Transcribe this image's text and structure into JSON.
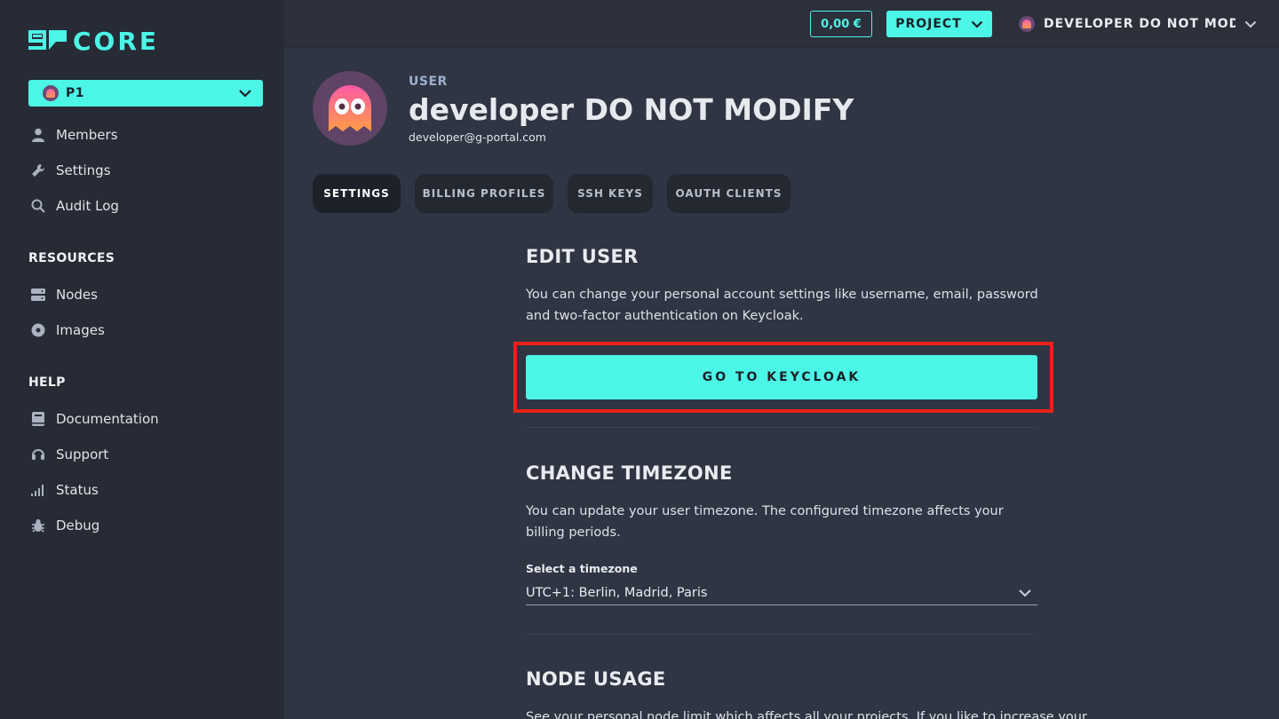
{
  "brand": {
    "name": "CORE",
    "accent": "#4cf6e6"
  },
  "sidebar": {
    "project": {
      "name": "P1"
    },
    "main_items": [
      {
        "label": "Members",
        "icon": "user-icon"
      },
      {
        "label": "Settings",
        "icon": "wrench-icon"
      },
      {
        "label": "Audit Log",
        "icon": "search-icon"
      }
    ],
    "resources": {
      "title": "RESOURCES",
      "items": [
        {
          "label": "Nodes",
          "icon": "server-icon"
        },
        {
          "label": "Images",
          "icon": "disc-icon"
        }
      ]
    },
    "help": {
      "title": "HELP",
      "items": [
        {
          "label": "Documentation",
          "icon": "book-icon"
        },
        {
          "label": "Support",
          "icon": "headset-icon"
        },
        {
          "label": "Status",
          "icon": "signal-icon"
        },
        {
          "label": "Debug",
          "icon": "bug-icon"
        }
      ]
    }
  },
  "topbar": {
    "balance": "0,00 €",
    "project_label": "PROJECT",
    "user_label": "DEVELOPER DO NOT MODI..."
  },
  "header": {
    "kicker": "USER",
    "name": "developer DO NOT MODIFY",
    "email": "developer@g-portal.com"
  },
  "tabs": [
    {
      "label": "SETTINGS",
      "active": true
    },
    {
      "label": "BILLING PROFILES",
      "active": false
    },
    {
      "label": "SSH KEYS",
      "active": false
    },
    {
      "label": "OAUTH CLIENTS",
      "active": false
    }
  ],
  "edit_user": {
    "title": "EDIT USER",
    "description": "You can change your personal account settings like username, email, password and two-factor authentication on Keycloak.",
    "button": "GO TO KEYCLOAK"
  },
  "timezone": {
    "title": "CHANGE TIMEZONE",
    "description": "You can update your user timezone. The configured timezone affects your billing periods.",
    "field_label": "Select a timezone",
    "selected": "UTC+1: Berlin, Madrid, Paris"
  },
  "node_usage": {
    "title": "NODE USAGE",
    "description": "See your personal node limit which affects all your projects. If you like to increase your"
  }
}
